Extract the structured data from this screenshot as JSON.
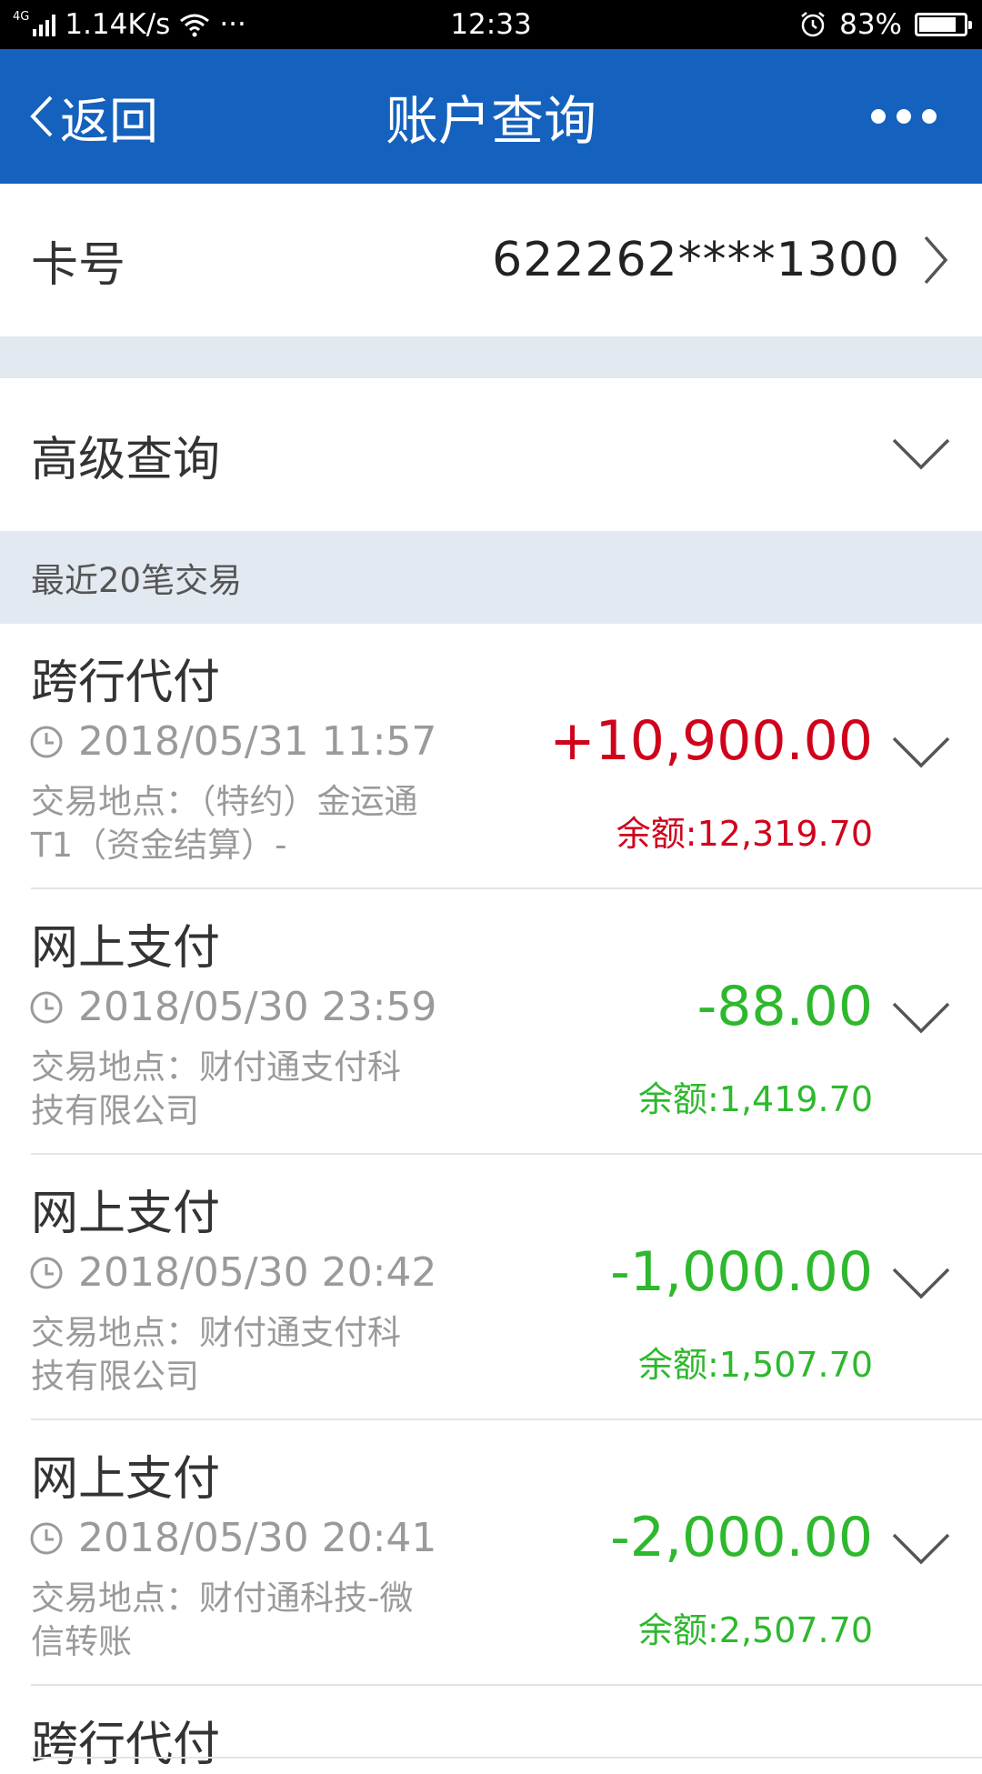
{
  "status_bar": {
    "network": "4G",
    "speed": "1.14K/s",
    "more": "···",
    "time": "12:33",
    "battery": "83%",
    "battery_level": 0.83
  },
  "header": {
    "back_label": "返回",
    "title": "账户查询",
    "more_icon": "more-dots-icon"
  },
  "card": {
    "label": "卡号",
    "value": "622262****1300"
  },
  "advanced": {
    "label": "高级查询"
  },
  "section": {
    "title": "最近20笔交易"
  },
  "colors": {
    "header_bg": "#1461be",
    "income": "#d0021b",
    "expense": "#2eb82e",
    "band": "#e3e9f1"
  },
  "transactions": [
    {
      "type": "跨行代付",
      "time": "2018/05/31 11:57",
      "place": "交易地点：（特约）金运通T1（资金结算）-",
      "amount": "+10,900.00",
      "balance": "余额:12,319.70",
      "direction": "income"
    },
    {
      "type": "网上支付",
      "time": "2018/05/30 23:59",
      "place": "交易地点：财付通支付科技有限公司",
      "amount": "-88.00",
      "balance": "余额:1,419.70",
      "direction": "expense"
    },
    {
      "type": "网上支付",
      "time": "2018/05/30 20:42",
      "place": "交易地点：财付通支付科技有限公司",
      "amount": "-1,000.00",
      "balance": "余额:1,507.70",
      "direction": "expense"
    },
    {
      "type": "网上支付",
      "time": "2018/05/30 20:41",
      "place": "交易地点：财付通科技-微信转账",
      "amount": "-2,000.00",
      "balance": "余额:2,507.70",
      "direction": "expense"
    },
    {
      "type": "跨行代付"
    }
  ]
}
